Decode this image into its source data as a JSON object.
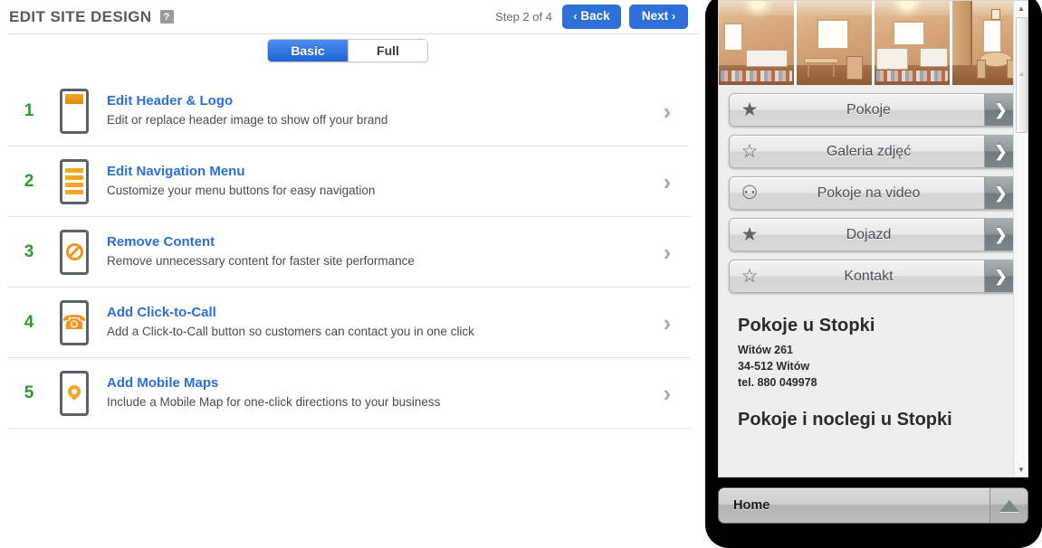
{
  "header": {
    "title": "EDIT SITE DESIGN",
    "help_icon": "?",
    "step_label": "Step 2 of 4",
    "back_label": "Back",
    "back_chevron": "‹",
    "next_label": "Next",
    "next_chevron": "›"
  },
  "toggle": {
    "options": [
      {
        "label": "Basic",
        "active": true
      },
      {
        "label": "Full",
        "active": false
      }
    ]
  },
  "tasks": [
    {
      "number": "1",
      "title": "Edit Header & Logo",
      "desc": "Edit or replace header image to show off your brand",
      "icon": "phone-header-icon",
      "chevron": "›"
    },
    {
      "number": "2",
      "title": "Edit Navigation Menu",
      "desc": "Customize your menu buttons for easy navigation",
      "icon": "phone-menu-lines-icon",
      "chevron": "›"
    },
    {
      "number": "3",
      "title": "Remove Content",
      "desc": "Remove unnecessary content for faster site performance",
      "icon": "phone-no-entry-icon",
      "chevron": "›"
    },
    {
      "number": "4",
      "title": "Add Click-to-Call",
      "desc": "Add a Click-to-Call button so customers can contact you in one click",
      "icon": "phone-handset-icon",
      "chevron": "›"
    },
    {
      "number": "5",
      "title": "Add Mobile Maps",
      "desc": "Include a Mobile Map for one-click directions to your business",
      "icon": "phone-map-pin-icon",
      "chevron": "›"
    }
  ],
  "preview": {
    "thumbnails": [
      {
        "alt": "bedroom-with-single-bed"
      },
      {
        "alt": "room-with-wooden-table"
      },
      {
        "alt": "bedroom-with-two-beds"
      },
      {
        "alt": "dining-room-with-table"
      }
    ],
    "menu_buttons": [
      {
        "label": "Pokoje",
        "icon": "star-filled-icon",
        "glyph": "★",
        "arrow": "❯"
      },
      {
        "label": "Galeria zdjęć",
        "icon": "star-outline-icon",
        "glyph": "☆",
        "arrow": "❯"
      },
      {
        "label": "Pokoje na video",
        "icon": "film-reel-icon",
        "glyph": "⚇",
        "arrow": "❯"
      },
      {
        "label": "Dojazd",
        "icon": "star-filled-icon",
        "glyph": "★",
        "arrow": "❯"
      },
      {
        "label": "Kontakt",
        "icon": "star-outline-icon",
        "glyph": "☆",
        "arrow": "❯"
      }
    ],
    "business_name": "Pokoje u Stopki",
    "address_line1": "Witów 261",
    "address_line2": "34-512 Witów",
    "phone_line": "tel. 880 049978",
    "heading2": "Pokoje i noclegi u Stopki",
    "scrollbar": {
      "up_arrow": "▲",
      "down_arrow": "▼",
      "grip": "≡"
    },
    "bottom_bar": {
      "home_label": "Home",
      "up_icon": "triangle-up-icon"
    }
  },
  "colors": {
    "accent_blue": "#2b6fd8",
    "number_green": "#2a9d2a",
    "icon_orange": "#f5a623",
    "title_gray": "#555b5f"
  }
}
